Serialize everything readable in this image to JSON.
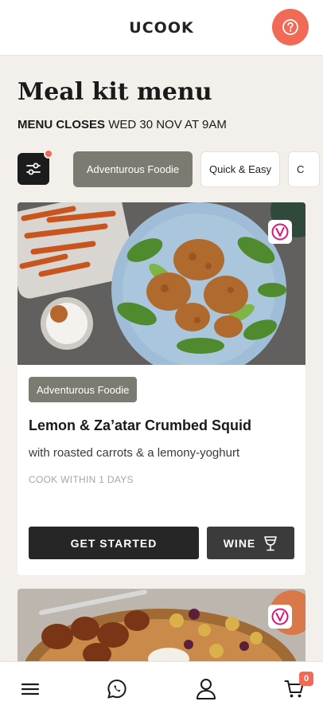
{
  "header": {
    "logo": "UCOOK",
    "help_icon": "question-icon"
  },
  "page": {
    "title": "Meal kit menu",
    "closes_label": "MENU CLOSES",
    "closes_date": "WED 30 NOV AT 9AM"
  },
  "filters": {
    "filter_icon": "sliders-icon",
    "chips": [
      {
        "label": "Adventurous Foodie",
        "active": true
      },
      {
        "label": "Quick & Easy",
        "active": false
      },
      {
        "label": "C",
        "active": false
      }
    ]
  },
  "recipe": {
    "tag": "Adventurous Foodie",
    "title": "Lemon & Za’atar Crumbed Squid",
    "subtitle": "with roasted carrots & a lemony-yoghurt",
    "cook_within": "COOK WITHIN 1 DAYS",
    "cta_primary": "GET STARTED",
    "cta_secondary": "WINE",
    "badge_icon": "vegetarian-v-icon",
    "wine_icon": "wine-glass-icon"
  },
  "bottom_nav": {
    "items": [
      {
        "icon": "menu-icon"
      },
      {
        "icon": "whatsapp-icon"
      },
      {
        "icon": "user-icon"
      },
      {
        "icon": "cart-icon",
        "badge": "0"
      }
    ]
  },
  "colors": {
    "accent": "#f06a55",
    "chip_active": "#7b7b72",
    "background": "#f3f0ec",
    "dark_button": "#262626"
  }
}
